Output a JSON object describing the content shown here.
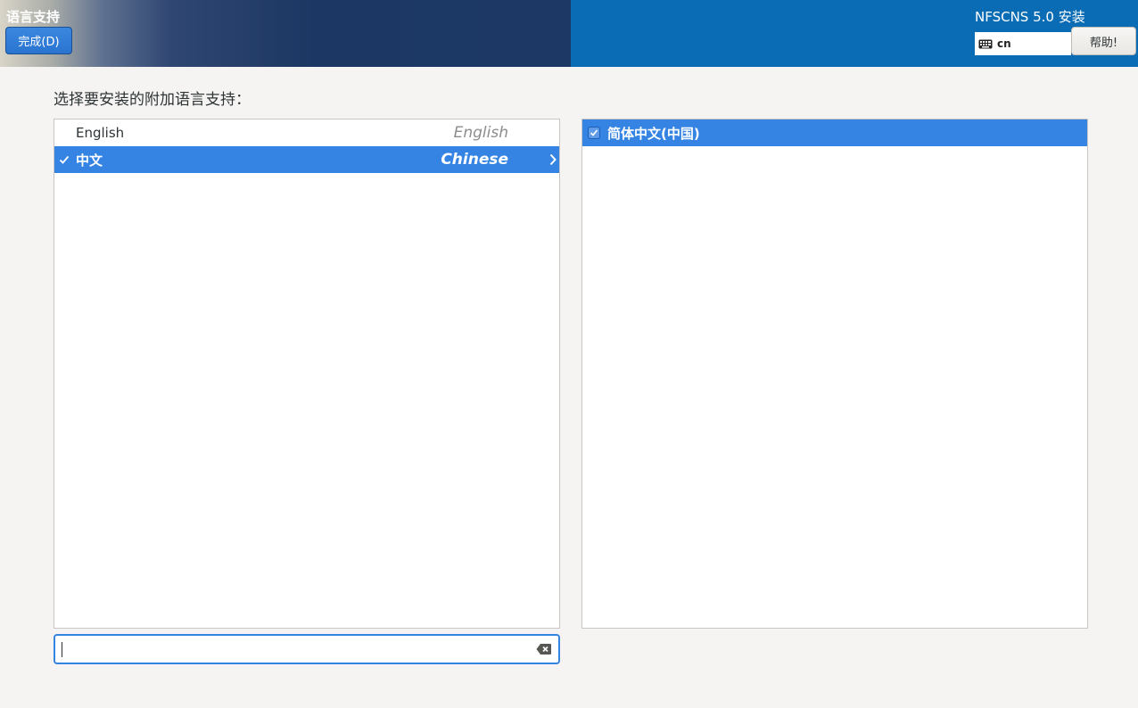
{
  "header": {
    "spoke_title": "语言支持",
    "done_button": "完成(D)",
    "product_title": "NFSCNS 5.0 安装",
    "keyboard_layout": "cn",
    "help_button": "帮助!"
  },
  "main": {
    "prompt": "选择要安装的附加语言支持：",
    "languages": [
      {
        "native": "English",
        "english": "English",
        "selected": false,
        "checked": false
      },
      {
        "native": "中文",
        "english": "Chinese",
        "selected": true,
        "checked": true
      }
    ],
    "locales": [
      {
        "label": "简体中文(中国)",
        "checked": true,
        "selected": true
      }
    ],
    "search": {
      "value": "",
      "placeholder": ""
    }
  },
  "icons": {
    "keyboard": "keyboard-icon",
    "check": "checkmark-icon",
    "arrow": "chevron-right-icon",
    "clear": "clear-text-icon"
  },
  "colors": {
    "accent": "#3584e4",
    "header_blue": "#0a6cb5"
  }
}
